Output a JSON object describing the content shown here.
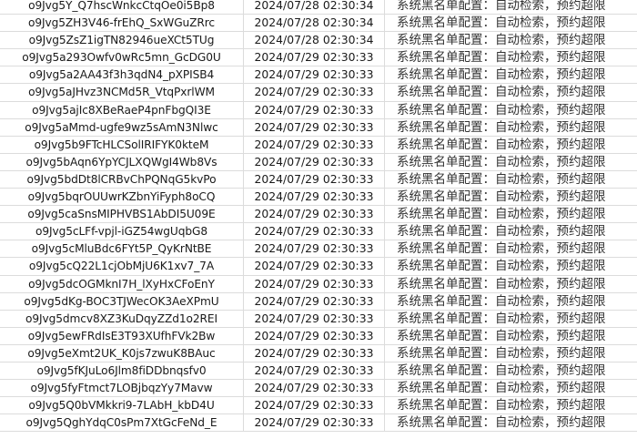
{
  "sheet": {
    "rows": [
      {
        "id": "o9Jvg5Y_Q7hscWnkcCtqOe0i5Bp8",
        "time": "2024/07/28 02:30:34",
        "message": "系统黑名单配置：自动检索，预约超限"
      },
      {
        "id": "o9Jvg5ZH3V46-frEhQ_SxWGuZRrc",
        "time": "2024/07/28 02:30:34",
        "message": "系统黑名单配置：自动检索，预约超限"
      },
      {
        "id": "o9Jvg5ZsZ1igTN82946ueXCt5TUg",
        "time": "2024/07/28 02:30:34",
        "message": "系统黑名单配置：自动检索，预约超限"
      },
      {
        "id": "o9Jvg5a293Owfv0wRc5mn_GcDG0U",
        "time": "2024/07/29 02:30:33",
        "message": "系统黑名单配置：自动检索，预约超限"
      },
      {
        "id": "o9Jvg5a2AA43f3h3qdN4_pXPISB4",
        "time": "2024/07/29 02:30:33",
        "message": "系统黑名单配置：自动检索，预约超限"
      },
      {
        "id": "o9Jvg5aJHvz3NCMd5R_VtqPxrlWM",
        "time": "2024/07/29 02:30:33",
        "message": "系统黑名单配置：自动检索，预约超限"
      },
      {
        "id": "o9Jvg5ajIc8XBeRaeP4pnFbgQI3E",
        "time": "2024/07/29 02:30:33",
        "message": "系统黑名单配置：自动检索，预约超限"
      },
      {
        "id": "o9Jvg5aMmd-ugfe9wz5sAmN3Nlwc",
        "time": "2024/07/29 02:30:33",
        "message": "系统黑名单配置：自动检索，预约超限"
      },
      {
        "id": "o9Jvg5b9FTcHLCSolIRIFYK0kteM",
        "time": "2024/07/29 02:30:33",
        "message": "系统黑名单配置：自动检索，预约超限"
      },
      {
        "id": "o9Jvg5bAqn6YpYCJLXQWgI4Wb8Vs",
        "time": "2024/07/29 02:30:33",
        "message": "系统黑名单配置：自动检索，预约超限"
      },
      {
        "id": "o9Jvg5bdDt8lCRBvChPQNqG5kvPo",
        "time": "2024/07/29 02:30:33",
        "message": "系统黑名单配置：自动检索，预约超限"
      },
      {
        "id": "o9Jvg5bqrOUUwrKZbnYiFyph8oCQ",
        "time": "2024/07/29 02:30:33",
        "message": "系统黑名单配置：自动检索，预约超限"
      },
      {
        "id": "o9Jvg5caSnsMIPHVBS1AbDI5U09E",
        "time": "2024/07/29 02:30:33",
        "message": "系统黑名单配置：自动检索，预约超限"
      },
      {
        "id": "o9Jvg5cLFf-vpjl-iGZ54wgUqbG8",
        "time": "2024/07/29 02:30:33",
        "message": "系统黑名单配置：自动检索，预约超限"
      },
      {
        "id": "o9Jvg5cMluBdc6FYt5P_QyKrNtBE",
        "time": "2024/07/29 02:30:33",
        "message": "系统黑名单配置：自动检索，预约超限"
      },
      {
        "id": "o9Jvg5cQ22L1cjObMjU6K1xv7_7A",
        "time": "2024/07/29 02:30:33",
        "message": "系统黑名单配置：自动检索，预约超限"
      },
      {
        "id": "o9Jvg5dcOGMknI7H_lXyHxCFoEnY",
        "time": "2024/07/29 02:30:33",
        "message": "系统黑名单配置：自动检索，预约超限"
      },
      {
        "id": "o9Jvg5dKg-BOC3TJWecOK3AeXPmU",
        "time": "2024/07/29 02:30:33",
        "message": "系统黑名单配置：自动检索，预约超限"
      },
      {
        "id": "o9Jvg5dmcv8XZ3KuDqyZZd1o2REI",
        "time": "2024/07/29 02:30:33",
        "message": "系统黑名单配置：自动检索，预约超限"
      },
      {
        "id": "o9Jvg5ewFRdIsE3T93XUfhFVk2Bw",
        "time": "2024/07/29 02:30:33",
        "message": "系统黑名单配置：自动检索，预约超限"
      },
      {
        "id": "o9Jvg5eXmt2UK_K0js7zwuK8BAuc",
        "time": "2024/07/29 02:30:33",
        "message": "系统黑名单配置：自动检索，预约超限"
      },
      {
        "id": "o9Jvg5fKJuLo6Jlm8fiDDbnqsfv0",
        "time": "2024/07/29 02:30:33",
        "message": "系统黑名单配置：自动检索，预约超限"
      },
      {
        "id": "o9Jvg5fyFtmct7LOBjbqzYy7Mavw",
        "time": "2024/07/29 02:30:33",
        "message": "系统黑名单配置：自动检索，预约超限"
      },
      {
        "id": "o9Jvg5Q0bVMkkri9-7LAbH_kbD4U",
        "time": "2024/07/29 02:30:33",
        "message": "系统黑名单配置：自动检索，预约超限"
      },
      {
        "id": "o9Jvg5QghYdqC0sPm7XtGcFeNd_E",
        "time": "2024/07/29 02:30:33",
        "message": "系统黑名单配置：自动检索，预约超限"
      }
    ]
  }
}
